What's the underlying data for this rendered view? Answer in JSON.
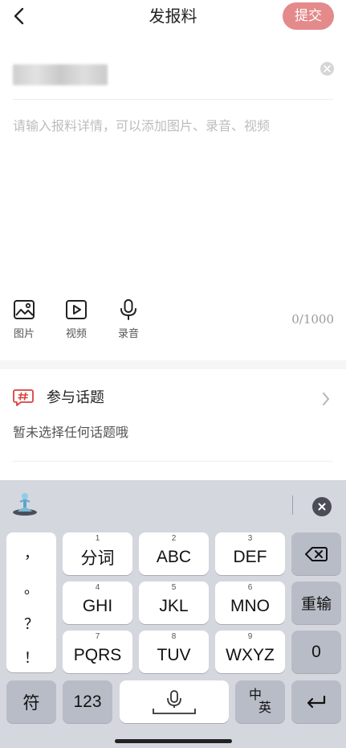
{
  "header": {
    "title": "发报料",
    "submit_label": "提交"
  },
  "form": {
    "content_placeholder": "请输入报料详情，可以添加图片、录音、视频",
    "counter": "0/1000"
  },
  "media_tools": [
    {
      "label": "图片",
      "icon": "image-icon"
    },
    {
      "label": "视频",
      "icon": "video-icon"
    },
    {
      "label": "录音",
      "icon": "microphone-icon"
    }
  ],
  "topic": {
    "title": "参与话题",
    "hint": "暂未选择任何话题哦"
  },
  "keyboard": {
    "punctuation": [
      "，",
      "。",
      "？",
      "！"
    ],
    "row1": [
      {
        "num": "1",
        "label": "分词"
      },
      {
        "num": "2",
        "label": "ABC"
      },
      {
        "num": "3",
        "label": "DEF"
      }
    ],
    "row2": [
      {
        "num": "4",
        "label": "GHI"
      },
      {
        "num": "5",
        "label": "JKL"
      },
      {
        "num": "6",
        "label": "MNO"
      }
    ],
    "row3": [
      {
        "num": "7",
        "label": "PQRS"
      },
      {
        "num": "8",
        "label": "TUV"
      },
      {
        "num": "9",
        "label": "WXYZ"
      }
    ],
    "reenter": "重输",
    "zero": "0",
    "symbols": "符",
    "numbers": "123",
    "lang_top": "中",
    "lang_bottom": "英"
  },
  "colors": {
    "submit_bg": "#e48a8b",
    "topic_accent": "#d9413f",
    "keyboard_bg": "#d5d7de"
  }
}
